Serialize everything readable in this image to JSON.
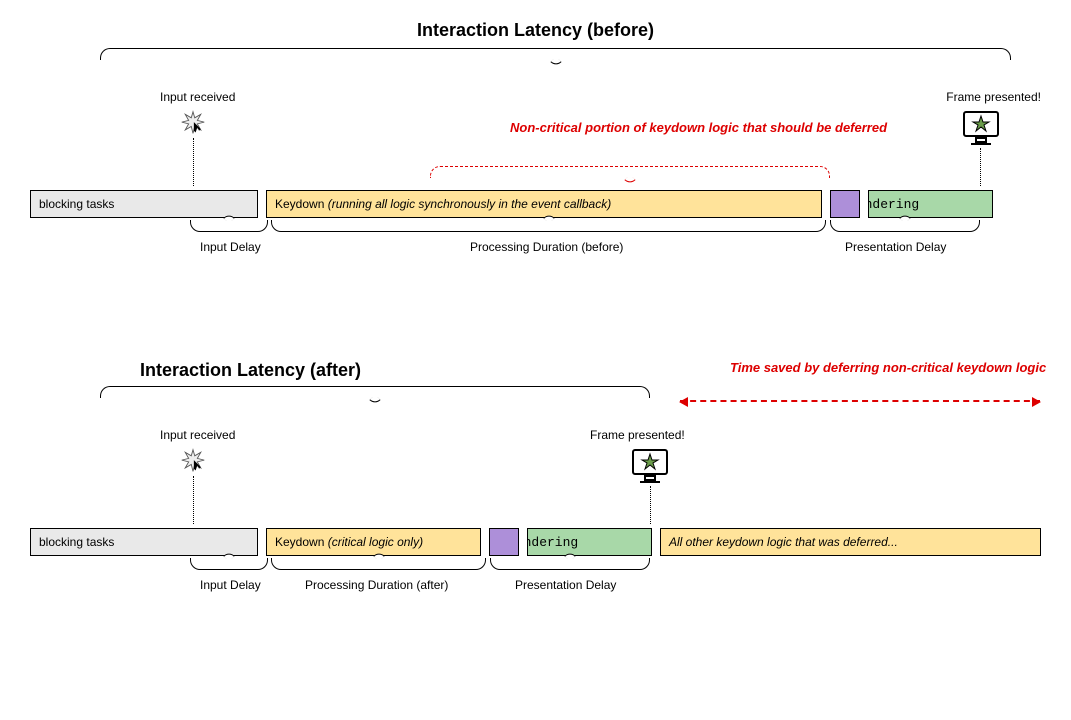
{
  "before": {
    "title": "Interaction Latency (before)",
    "input_received": "Input received",
    "frame_presented": "Frame presented!",
    "noncritical_note": "Non-critical portion of keydown logic that should be deferred",
    "blocking": "blocking tasks",
    "keydown_prefix": "Keydown ",
    "keydown_desc": "(running all logic synchronously in the event callback)",
    "rendering": "rendering",
    "input_delay": "Input Delay",
    "processing_duration": "Processing Duration (before)",
    "presentation_delay": "Presentation Delay"
  },
  "after": {
    "title": "Interaction Latency (after)",
    "time_saved": "Time saved by deferring non-critical keydown logic",
    "input_received": "Input received",
    "frame_presented": "Frame presented!",
    "blocking": "blocking tasks",
    "keydown_prefix": "Keydown ",
    "keydown_desc": "(critical logic only)",
    "rendering": "rendering",
    "deferred": "All other keydown logic that was deferred...",
    "input_delay": "Input Delay",
    "processing_duration": "Processing Duration (after)",
    "presentation_delay": "Presentation Delay"
  }
}
